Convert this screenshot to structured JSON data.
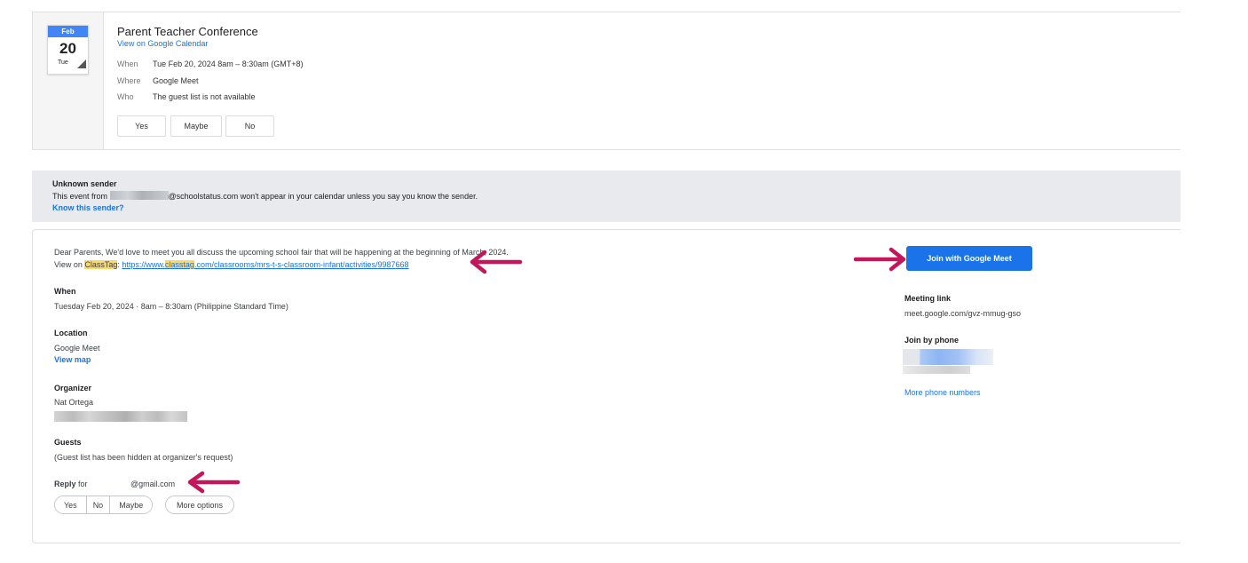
{
  "event": {
    "month": "Feb",
    "day": "20",
    "weekday": "Tue",
    "title": "Parent Teacher Conference",
    "calendar_link": "View on Google Calendar",
    "when_label": "When",
    "when_value": "Tue Feb 20, 2024 8am – 8:30am (GMT+8)",
    "where_label": "Where",
    "where_value": "Google Meet",
    "who_label": "Who",
    "who_value": "The guest list is not available",
    "buttons": {
      "yes": "Yes",
      "maybe": "Maybe",
      "no": "No"
    }
  },
  "banner": {
    "title": "Unknown sender",
    "text_before": "This event from ",
    "text_after": "@schoolstatus.com won't appear in your calendar unless you say you know the sender.",
    "link": "Know this sender?"
  },
  "details": {
    "intro": "Dear Parents, We'd love to meet you all discuss the upcoming school fair that will be happening at the beginning of March, 2024.",
    "view_on": "View on ",
    "classtag": "ClassTag",
    "url_pre": "https://www.",
    "url_hl": "classtag",
    "url_post": ".com/classrooms/mrs-t-s-classroom-infant/activities/9987668",
    "when_head": "When",
    "when_value": "Tuesday Feb 20, 2024 · 8am – 8:30am (Philippine Standard Time)",
    "location_head": "Location",
    "location_value": "Google Meet",
    "view_map": "View map",
    "organizer_head": "Organizer",
    "organizer_name": "Nat Ortega",
    "guests_head": "Guests",
    "guests_value": "(Guest list has been hidden at organizer's request)",
    "reply_label": "Reply",
    "reply_for": " for ",
    "reply_email": "@gmail.com",
    "reply_buttons": {
      "yes": "Yes",
      "no": "No",
      "maybe": "Maybe"
    },
    "more_options": "More options"
  },
  "meet": {
    "join_button": "Join with Google Meet",
    "meeting_link_head": "Meeting link",
    "meeting_link": "meet.google.com/gvz-mmug-gso",
    "phone_head": "Join by phone",
    "more_numbers": "More phone numbers"
  },
  "colors": {
    "accent": "#1a73e8",
    "arrow": "#c2185b",
    "highlight": "#fcd966"
  }
}
